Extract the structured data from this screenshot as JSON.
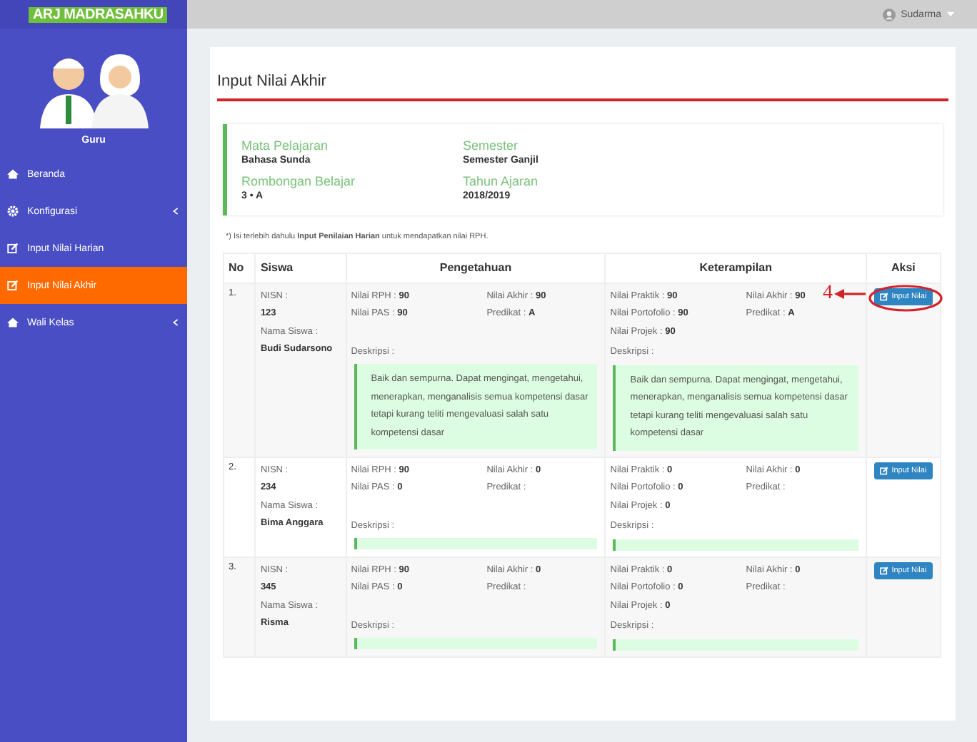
{
  "app": {
    "logo": "ARJ MADRASAHKU"
  },
  "profile": {
    "role": "Guru"
  },
  "sidebar": {
    "items": [
      {
        "label": "Beranda",
        "kind": "home",
        "submenu": false,
        "selected": false
      },
      {
        "label": "Konfigurasi",
        "kind": "settings",
        "submenu": true,
        "selected": false
      },
      {
        "label": "Input Nilai Harian",
        "kind": "form",
        "submenu": false,
        "selected": false
      },
      {
        "label": "Input Nilai Akhir",
        "kind": "form",
        "submenu": false,
        "selected": true
      },
      {
        "label": "Wali Kelas",
        "kind": "home",
        "submenu": true,
        "selected": false
      }
    ]
  },
  "topbar": {
    "user_name": "Sudarma"
  },
  "page": {
    "title": "Input Nilai Akhir"
  },
  "info": [
    {
      "label": "Mata Pelajaran",
      "value": "Bahasa Sunda"
    },
    {
      "label": "Semester",
      "value": "Semester Ganjil"
    },
    {
      "label": "Rombongan Belajar",
      "value": "3 • A"
    },
    {
      "label": "Tahun Ajaran",
      "value": "2018/2019"
    }
  ],
  "note": "*) Isi terlebih dahulu **Input Penilaian Harian** untuk mendapatkan nilai RPH.",
  "table": {
    "columns": [
      "No",
      "Siswa",
      "Pengetahuan",
      "Keterampilan",
      "Aksi"
    ],
    "rows": [
      {
        "no": "1.",
        "nisn_label": "NISN :",
        "nisn": "123",
        "name_label": "Nama Siswa :",
        "name": "Budi Sudarsono",
        "pengetahuan": {
          "left": [
            "Nilai RPH : **90**",
            "Nilai PAS : **90**"
          ],
          "right": [
            "Nilai Akhir : **90**",
            "Predikat : **A**"
          ],
          "desc_label": "Deskripsi :",
          "desc": "Baik dan sempurna. Dapat mengingat, mengetahui, menerapkan, menganalisis semua kompetensi dasar tetapi kurang teliti mengevaluasi salah satu kompetensi dasar"
        },
        "keterampilan": {
          "left": [
            "Nilai Praktik : **90**",
            "Nilai Portofolio : **90**",
            "Nilai Projek : **90**"
          ],
          "right": [
            "Nilai Akhir : **90**",
            "Predikat : **A**"
          ],
          "desc_label": "Deskripsi :",
          "desc": "Baik dan sempurna. Dapat mengingat, mengetahui, menerapkan, menganalisis semua kompetensi dasar tetapi kurang teliti mengevaluasi salah satu kompetensi dasar"
        },
        "button": "Input Nilai",
        "annotation": "4"
      },
      {
        "no": "2.",
        "nisn_label": "NISN :",
        "nisn": "234",
        "name_label": "Nama Siswa :",
        "name": "Bima Anggara",
        "pengetahuan": {
          "left": [
            "Nilai RPH : **90**",
            "Nilai PAS : **0**"
          ],
          "right": [
            "Nilai Akhir : **0**",
            "Predikat :"
          ],
          "desc_label": "Deskripsi :"
        },
        "keterampilan": {
          "left": [
            "Nilai Praktik : **0**",
            "Nilai Portofolio : **0**",
            "Nilai Projek : **0**"
          ],
          "right": [
            "Nilai Akhir : **0**",
            "Predikat :"
          ],
          "desc_label": "Deskripsi :"
        },
        "button": "Input Nilai"
      },
      {
        "no": "3.",
        "nisn_label": "NISN :",
        "nisn": "345",
        "name_label": "Nama Siswa :",
        "name": "Risma",
        "pengetahuan": {
          "left": [
            "Nilai RPH : **90**",
            "Nilai PAS : **0**"
          ],
          "right": [
            "Nilai Akhir : **0**",
            "Predikat :"
          ],
          "desc_label": "Deskripsi :"
        },
        "keterampilan": {
          "left": [
            "Nilai Praktik : **0**",
            "Nilai Portofolio : **0**",
            "Nilai Projek : **0**"
          ],
          "right": [
            "Nilai Akhir : **0**",
            "Predikat :"
          ],
          "desc_label": "Deskripsi :"
        },
        "button": "Input Nilai"
      }
    ]
  }
}
